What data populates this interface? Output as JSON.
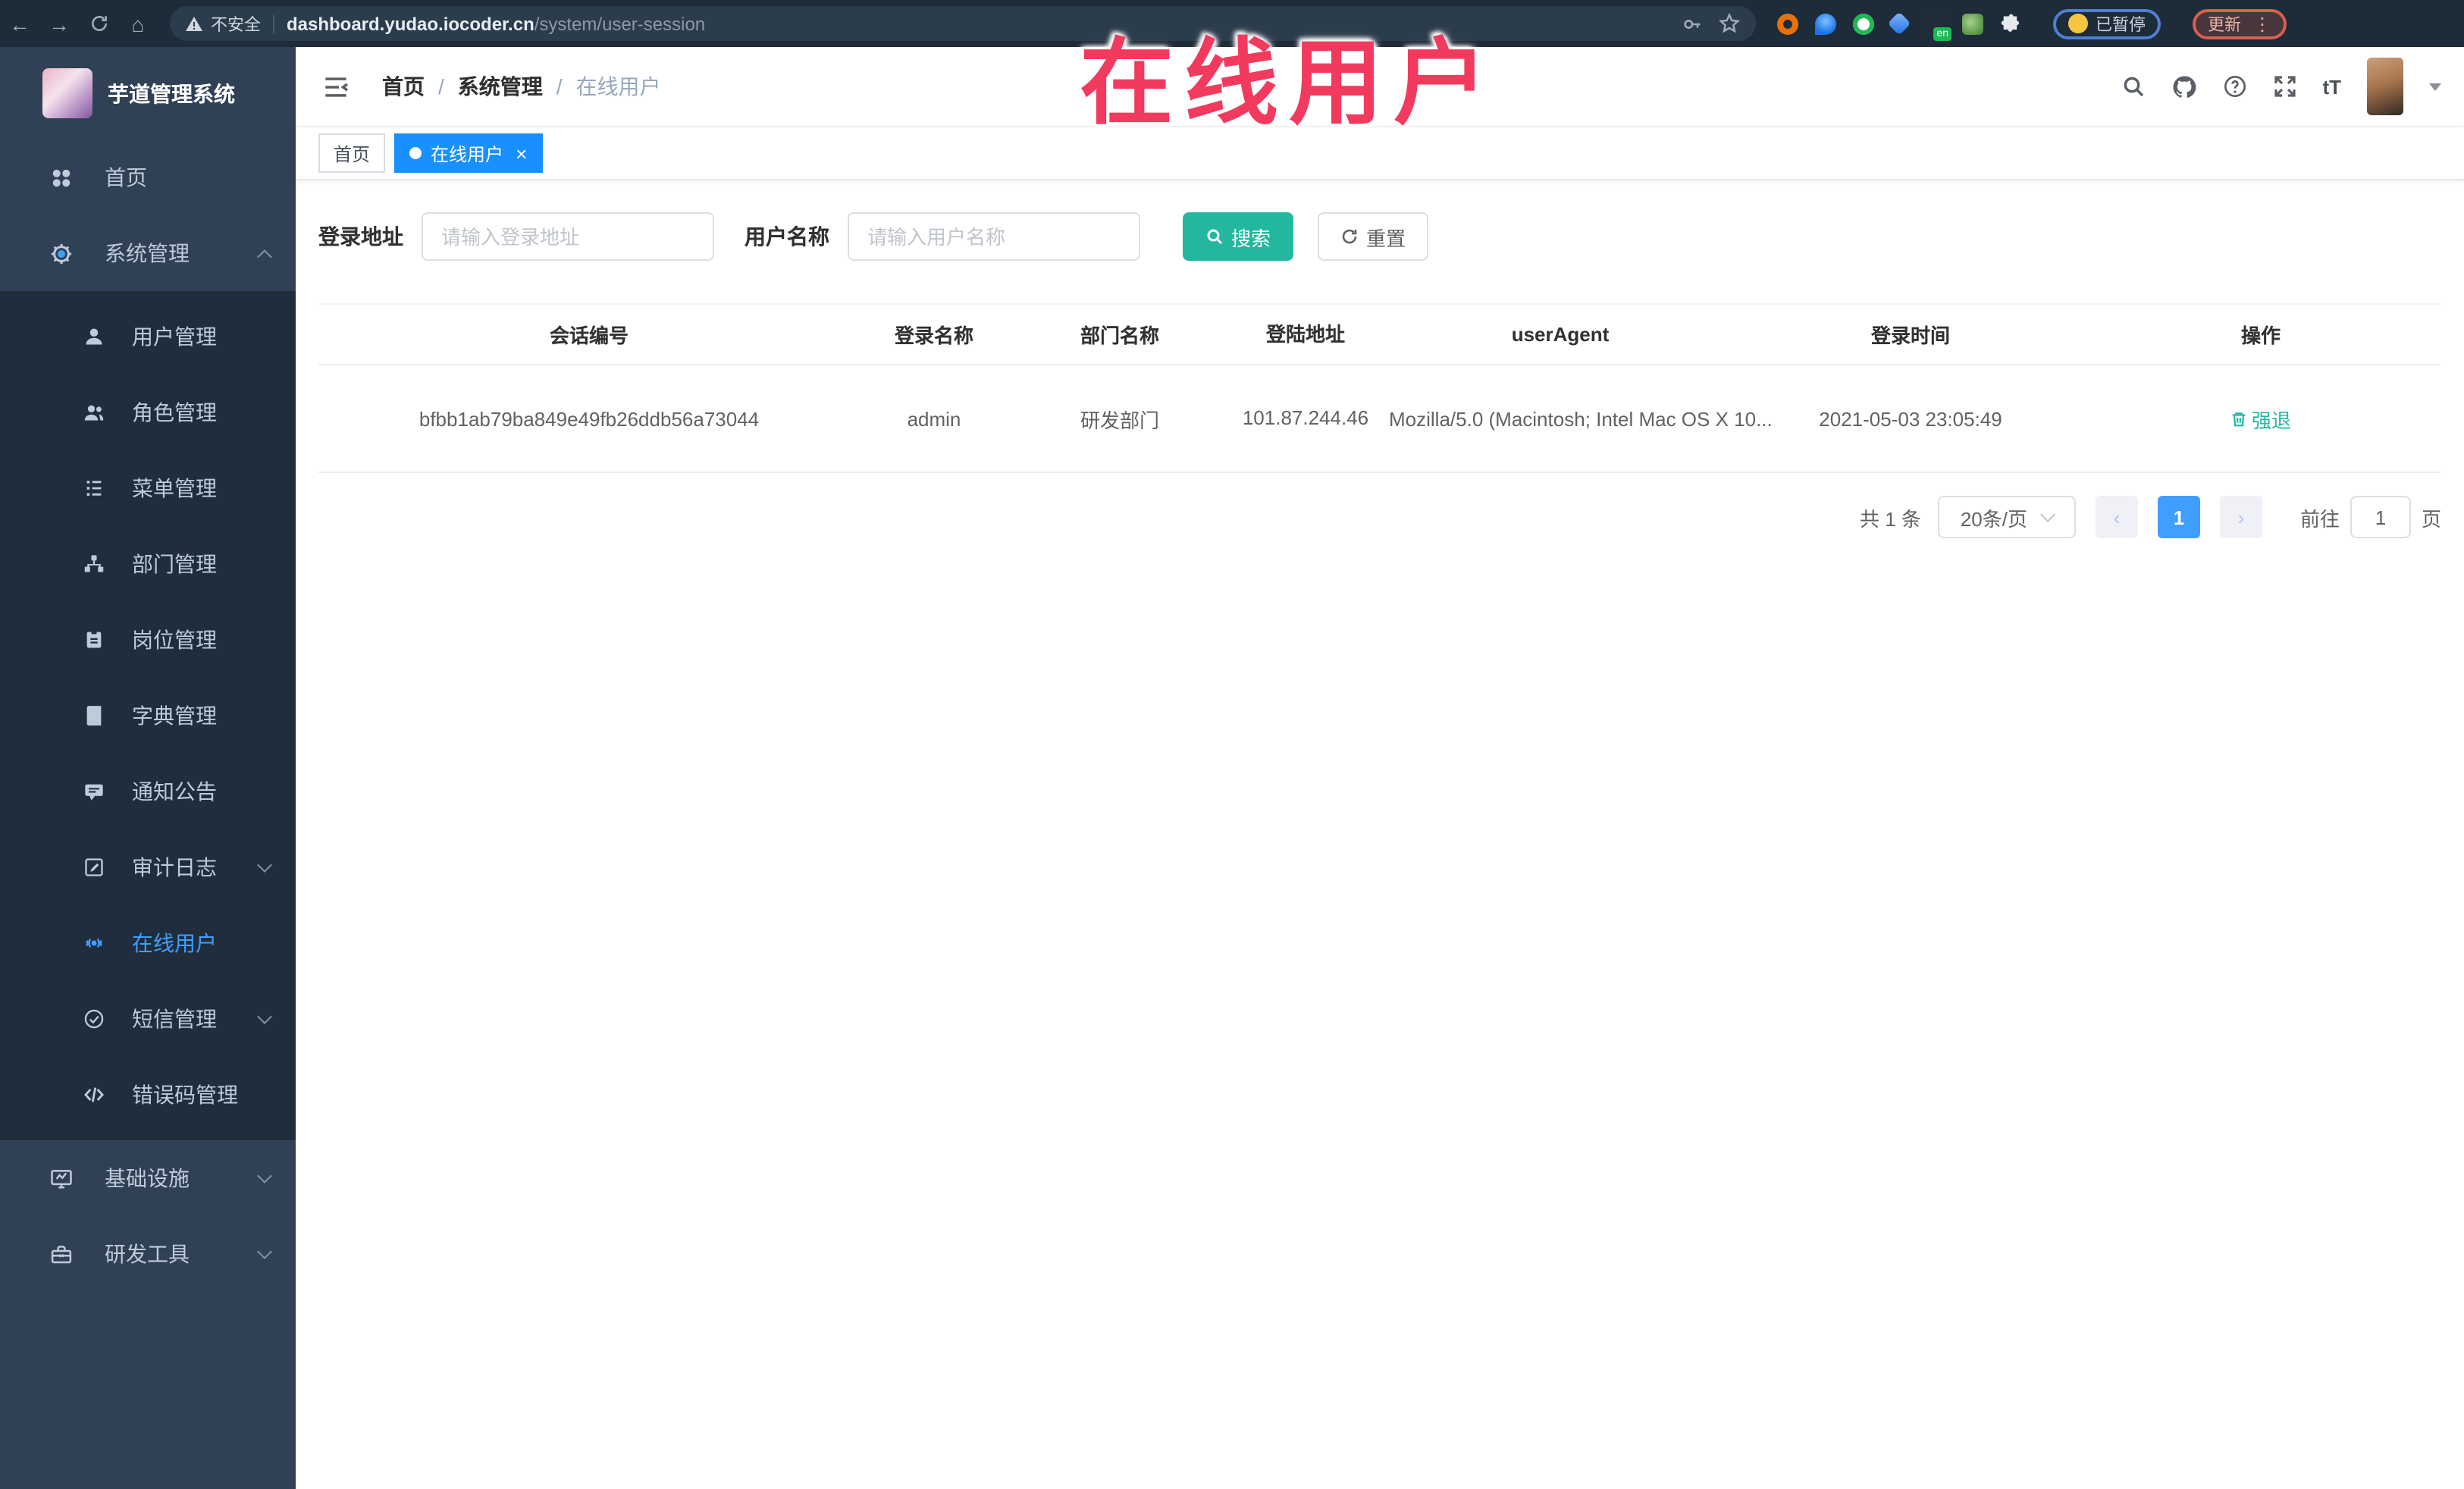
{
  "browser": {
    "back_icon": "back-arrow-icon",
    "forward_icon": "forward-arrow-icon",
    "reload_icon": "reload-icon",
    "home_icon": "home-icon",
    "security_label": "不安全",
    "url_domain": "dashboard.yudao.iocoder.cn",
    "url_path": "/system/user-session",
    "extension_en_badge": "en",
    "paused_chip_label": "已暂停",
    "update_button_label": "更新",
    "menu_dots": "⋮"
  },
  "overlay": {
    "title": "在线用户"
  },
  "sidebar": {
    "logo_title": "芋道管理系统",
    "top_items": [
      {
        "label": "首页",
        "icon": "home-dashboard-icon"
      },
      {
        "label": "系统管理",
        "icon": "gear-icon",
        "state": "expanded"
      }
    ],
    "system_children": [
      {
        "label": "用户管理",
        "icon": "user-icon"
      },
      {
        "label": "角色管理",
        "icon": "users-icon"
      },
      {
        "label": "菜单管理",
        "icon": "menu-list-icon"
      },
      {
        "label": "部门管理",
        "icon": "org-tree-icon"
      },
      {
        "label": "岗位管理",
        "icon": "id-badge-icon"
      },
      {
        "label": "字典管理",
        "icon": "book-icon"
      },
      {
        "label": "通知公告",
        "icon": "announcement-icon"
      },
      {
        "label": "审计日志",
        "icon": "audit-log-icon",
        "state": "collapsed"
      },
      {
        "label": "在线用户",
        "icon": "online-users-icon",
        "state": "active"
      },
      {
        "label": "短信管理",
        "icon": "sms-shield-icon",
        "state": "collapsed"
      },
      {
        "label": "错误码管理",
        "icon": "code-icon"
      }
    ],
    "bottom_items": [
      {
        "label": "基础设施",
        "icon": "monitor-icon",
        "state": "collapsed"
      },
      {
        "label": "研发工具",
        "icon": "toolbox-icon",
        "state": "collapsed"
      }
    ]
  },
  "topbar": {
    "breadcrumb": [
      {
        "label": "首页"
      },
      {
        "label": "系统管理"
      },
      {
        "label": "在线用户"
      }
    ],
    "separator": "/",
    "right_icons": [
      "search-icon",
      "github-icon",
      "help-icon",
      "fullscreen-icon",
      "font-size-icon",
      "avatar",
      "caret-down-icon"
    ],
    "font_size_icon_text": "tT"
  },
  "tabs": [
    {
      "label": "首页",
      "active": false
    },
    {
      "label": "在线用户",
      "active": true,
      "close": "×"
    }
  ],
  "filters": {
    "login_address_label": "登录地址",
    "login_address_placeholder": "请输入登录地址",
    "user_name_label": "用户名称",
    "user_name_placeholder": "请输入用户名称",
    "search_label": "搜索",
    "reset_label": "重置"
  },
  "table": {
    "headers": [
      "会话编号",
      "登录名称",
      "部门名称",
      "登陆地址",
      "userAgent",
      "登录时间",
      "操作"
    ],
    "rows": [
      {
        "session_id": "bfbb1ab79ba849e49fb26ddb56a73044",
        "login_name": "admin",
        "dept_name": "研发部门",
        "login_address": "101.87.244.46",
        "user_agent": "Mozilla/5.0 (Macintosh; Intel Mac OS X 10...",
        "login_time": "2021-05-03 23:05:49",
        "action_label": "强退"
      }
    ]
  },
  "pagination": {
    "total_text": "共 1 条",
    "page_size_text": "20条/页",
    "prev_icon": "‹",
    "current_page": "1",
    "next_icon": "›",
    "goto_label": "前往",
    "goto_value": "1",
    "page_unit": "页"
  }
}
